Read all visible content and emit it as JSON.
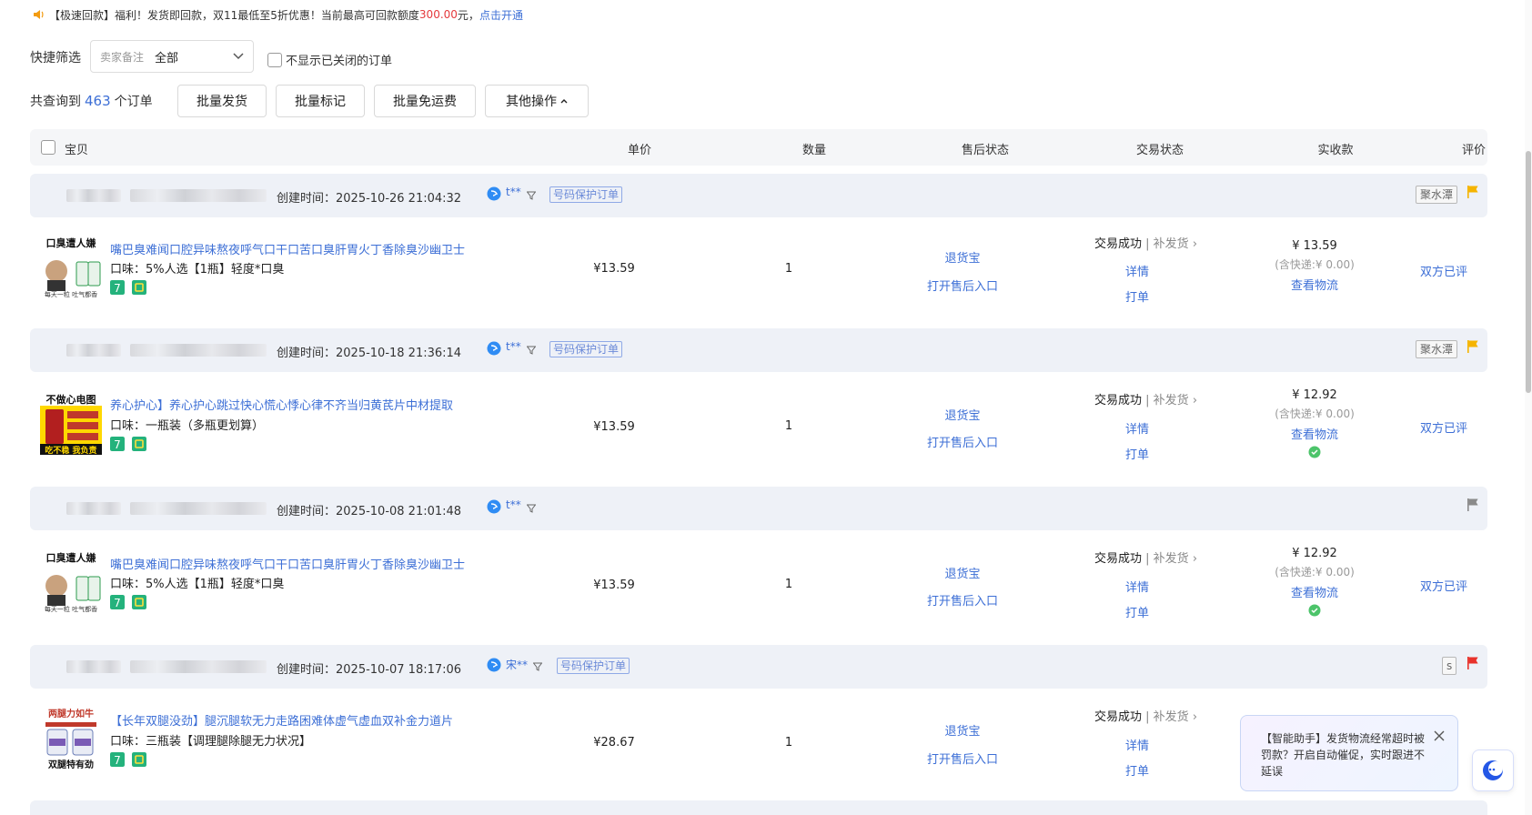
{
  "notice": {
    "prefix": "【极速回款】福利！发货即回款，双11最低至5折优惠！当前最高可回款额度",
    "amount": "300.00",
    "suffix": "元，",
    "link": "点击开通"
  },
  "filter": {
    "label": "快捷筛选",
    "select_label": "卖家备注",
    "select_value": "全部",
    "hide_closed": "不显示已关闭的订单"
  },
  "actions": {
    "total_prefix": "共查询到",
    "total_count": "463",
    "total_suffix": "个订单",
    "batch_ship": "批量发货",
    "batch_mark": "批量标记",
    "batch_free_shipping": "批量免运费",
    "more": "其他操作"
  },
  "table_header": {
    "product": "宝贝",
    "price": "单价",
    "qty": "数量",
    "aftersale": "售后状态",
    "trade": "交易状态",
    "received": "实收款",
    "review": "评价"
  },
  "orders": [
    {
      "created": "创建时间：2025-10-26 21:04:32",
      "buyer": "t**",
      "protect": "号码保护订单",
      "seal": "聚水潭",
      "flag_color": "#f5b400",
      "thumb_text_top": "口臭遭人嫌",
      "thumb_text_bottom": "每天一粒 吐气都香",
      "title": "嘴巴臭难闻口腔异味熬夜呼气口干口苦口臭肝胃火丁香除臭沙幽卫士",
      "spec": "口味：5%人选【1瓶】轻度*口臭",
      "price": "¥13.59",
      "qty": "1",
      "refund": "退货宝",
      "aftersale_entry": "打开售后入口",
      "trade_status": "交易成功",
      "reship": "补发货",
      "detail": "详情",
      "print": "打单",
      "received": "¥ 13.59",
      "shipping": "(含快递:¥ 0.00)",
      "logistics": "查看物流",
      "review": "双方已评"
    },
    {
      "created": "创建时间：2025-10-18 21:36:14",
      "buyer": "t**",
      "protect": "号码保护订单",
      "seal": "聚水潭",
      "flag_color": "#f5b400",
      "thumb_text_top": "不做心电图",
      "thumb_text_bottom": "吃不稳 我负责",
      "title": "养心护心】养心护心跳过快心慌心悸心律不齐当归黄芪片中材提取",
      "spec": "口味：一瓶装（多瓶更划算）",
      "price": "¥13.59",
      "qty": "1",
      "refund": "退货宝",
      "aftersale_entry": "打开售后入口",
      "trade_status": "交易成功",
      "reship": "补发货",
      "detail": "详情",
      "print": "打单",
      "received": "¥ 12.92",
      "shipping": "(含快递:¥ 0.00)",
      "logistics": "查看物流",
      "review": "双方已评"
    },
    {
      "created": "创建时间：2025-10-08 21:01:48",
      "buyer": "t**",
      "protect": "",
      "seal": "",
      "flag_color": "#8a8a8a",
      "thumb_text_top": "口臭遭人嫌",
      "thumb_text_bottom": "每天一粒 吐气都香",
      "title": "嘴巴臭难闻口腔异味熬夜呼气口干口苦口臭肝胃火丁香除臭沙幽卫士",
      "spec": "口味：5%人选【1瓶】轻度*口臭",
      "price": "¥13.59",
      "qty": "1",
      "refund": "退货宝",
      "aftersale_entry": "打开售后入口",
      "trade_status": "交易成功",
      "reship": "补发货",
      "detail": "详情",
      "print": "打单",
      "received": "¥ 12.92",
      "shipping": "(含快递:¥ 0.00)",
      "logistics": "查看物流",
      "review": "双方已评"
    },
    {
      "created": "创建时间：2025-10-07 18:17:06",
      "buyer": "宋**",
      "protect": "号码保护订单",
      "seal": "s",
      "flag_color": "#e8322b",
      "thumb_text_top": "两腿力如牛",
      "thumb_text_bottom": "双腿特有劲",
      "title": "【长年双腿没劲】腿沉腿软无力走路困难体虚气虚血双补金力道片",
      "spec": "口味：三瓶装【调理腿除腿无力状况】",
      "price": "¥28.67",
      "qty": "1",
      "refund": "退货宝",
      "aftersale_entry": "打开售后入口",
      "trade_status": "交易成功",
      "reship": "补发货",
      "detail": "详情",
      "print": "打单",
      "received": "",
      "shipping": "",
      "logistics": "",
      "review": ""
    }
  ],
  "assistant": {
    "text": "【智能助手】发货物流经常超时被罚款？开启自动催促，实时跟进不延误"
  },
  "colors": {
    "accent": "#3d6fd6",
    "order_header_bg": "#eef1f7",
    "table_header_bg": "#f5f6f8"
  }
}
